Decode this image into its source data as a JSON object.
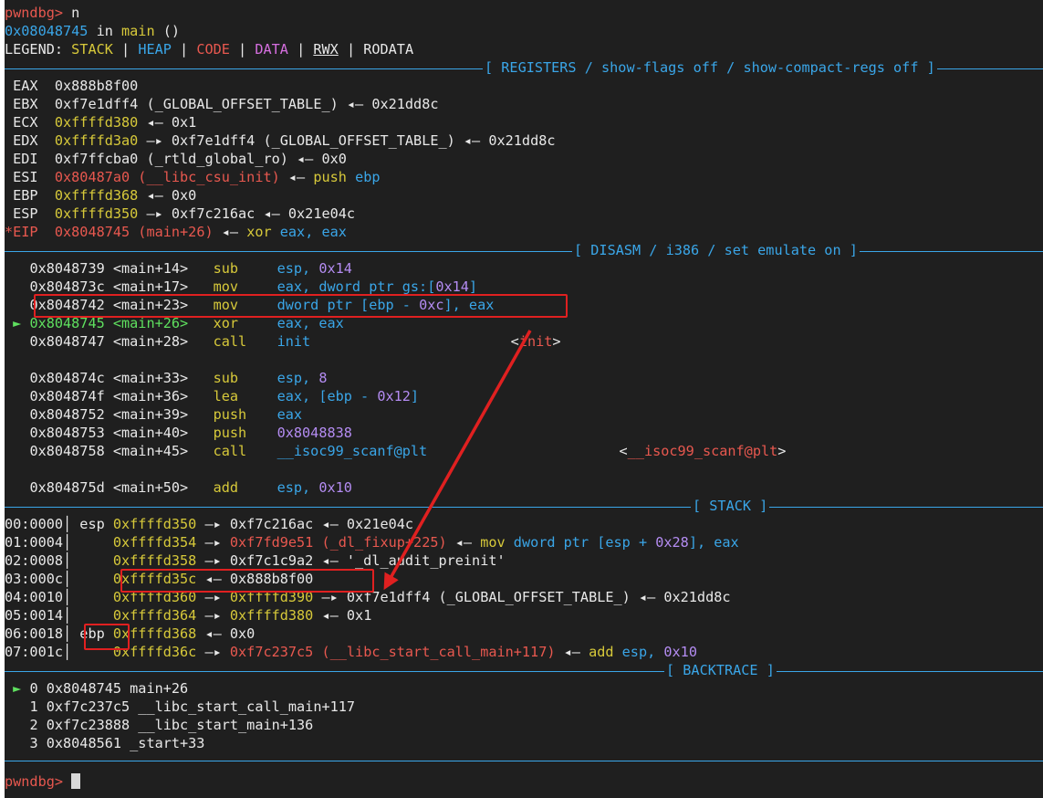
{
  "prompt": "pwndbg> ",
  "command": "n",
  "location": {
    "addr": "0x08048745",
    "in": " in ",
    "func": "main",
    "args": " ()"
  },
  "legend": {
    "label": "LEGEND: ",
    "stack": "STACK",
    "heap": "HEAP",
    "code": "CODE",
    "data": "DATA",
    "rwx": "RWX",
    "rodata": "RODATA",
    "sep": " | "
  },
  "headers": {
    "registers": "[ REGISTERS / show-flags off / show-compact-regs off ]",
    "disasm": "[ DISASM / i386 / set emulate on ]",
    "stack": "[ STACK ]",
    "backtrace": "[ BACKTRACE ]"
  },
  "registers": [
    {
      "name": " EAX",
      "segs": [
        {
          "t": "0x888b8f00",
          "c": "wht"
        }
      ]
    },
    {
      "name": " EBX",
      "segs": [
        {
          "t": "0xf7e1dff4 (_GLOBAL_OFFSET_TABLE_) ",
          "c": "wht"
        },
        {
          "t": "◂— ",
          "c": "wht"
        },
        {
          "t": "0x21dd8c",
          "c": "wht"
        }
      ]
    },
    {
      "name": " ECX",
      "segs": [
        {
          "t": "0xffffd380",
          "c": "yel"
        },
        {
          "t": " ◂— 0x1",
          "c": "wht"
        }
      ]
    },
    {
      "name": " EDX",
      "segs": [
        {
          "t": "0xffffd3a0",
          "c": "yel"
        },
        {
          "t": " —▸ 0xf7e1dff4 (_GLOBAL_OFFSET_TABLE_) ◂— 0x21dd8c",
          "c": "wht"
        }
      ]
    },
    {
      "name": " EDI",
      "segs": [
        {
          "t": "0xf7ffcba0 (_rtld_global_ro) ◂— 0x0",
          "c": "wht"
        }
      ]
    },
    {
      "name": " ESI",
      "segs": [
        {
          "t": "0x80487a0 (__libc_csu_init)",
          "c": "red"
        },
        {
          "t": " ◂— ",
          "c": "wht"
        },
        {
          "t": "push",
          "c": "yel"
        },
        {
          "t": " ebp",
          "c": "blu"
        }
      ]
    },
    {
      "name": " EBP",
      "segs": [
        {
          "t": "0xffffd368",
          "c": "yel"
        },
        {
          "t": " ◂— 0x0",
          "c": "wht"
        }
      ]
    },
    {
      "name": " ESP",
      "segs": [
        {
          "t": "0xffffd350",
          "c": "yel"
        },
        {
          "t": " —▸ 0xf7c216ac ◂— 0x21e04c",
          "c": "wht"
        }
      ]
    },
    {
      "name": "*EIP",
      "namec": "red",
      "segs": [
        {
          "t": "0x8048745 (main+26)",
          "c": "red"
        },
        {
          "t": " ◂— ",
          "c": "wht"
        },
        {
          "t": "xor",
          "c": "yel"
        },
        {
          "t": " eax, eax",
          "c": "blu"
        }
      ]
    }
  ],
  "disasm": [
    {
      "pre": "   ",
      "addr": "0x8048739 <main+14>   ",
      "op": "sub",
      "args": [
        {
          "t": "esp, ",
          "c": "blu"
        },
        {
          "t": "0x14",
          "c": "pur"
        }
      ]
    },
    {
      "pre": "   ",
      "addr": "0x804873c <main+17>   ",
      "op": "mov",
      "args": [
        {
          "t": "eax, dword ptr gs:[",
          "c": "blu"
        },
        {
          "t": "0x14",
          "c": "pur"
        },
        {
          "t": "]",
          "c": "blu"
        }
      ]
    },
    {
      "pre": "   ",
      "addr": "0x8048742 <main+23>   ",
      "op": "mov",
      "args": [
        {
          "t": "dword ptr [ebp - ",
          "c": "blu"
        },
        {
          "t": "0xc",
          "c": "pur"
        },
        {
          "t": "], eax",
          "c": "blu"
        }
      ]
    },
    {
      "pre": " ► ",
      "cur": true,
      "addr": "0x8048745 <main+26>   ",
      "op": "xor",
      "args": [
        {
          "t": "eax, eax",
          "c": "blu"
        }
      ]
    },
    {
      "pre": "   ",
      "addr": "0x8048747 <main+28>   ",
      "op": "call",
      "args": [
        {
          "t": "init",
          "c": "blu"
        },
        {
          "t": "                        ",
          "c": "wht"
        },
        {
          "t": "<",
          "c": "wht"
        },
        {
          "t": "init",
          "c": "red"
        },
        {
          "t": ">",
          "c": "wht"
        }
      ]
    },
    {
      "blank": true
    },
    {
      "pre": "   ",
      "addr": "0x804874c <main+33>   ",
      "op": "sub",
      "args": [
        {
          "t": "esp, ",
          "c": "blu"
        },
        {
          "t": "8",
          "c": "pur"
        }
      ]
    },
    {
      "pre": "   ",
      "addr": "0x804874f <main+36>   ",
      "op": "lea",
      "args": [
        {
          "t": "eax, [ebp - ",
          "c": "blu"
        },
        {
          "t": "0x12",
          "c": "pur"
        },
        {
          "t": "]",
          "c": "blu"
        }
      ]
    },
    {
      "pre": "   ",
      "addr": "0x8048752 <main+39>   ",
      "op": "push",
      "args": [
        {
          "t": "eax",
          "c": "blu"
        }
      ]
    },
    {
      "pre": "   ",
      "addr": "0x8048753 <main+40>   ",
      "op": "push",
      "args": [
        {
          "t": "0x8048838",
          "c": "pur"
        }
      ]
    },
    {
      "pre": "   ",
      "addr": "0x8048758 <main+45>   ",
      "op": "call",
      "args": [
        {
          "t": "__isoc99_scanf@plt",
          "c": "blu"
        },
        {
          "t": "                       ",
          "c": "wht"
        },
        {
          "t": "<",
          "c": "wht"
        },
        {
          "t": "__isoc99_scanf@plt",
          "c": "red"
        },
        {
          "t": ">",
          "c": "wht"
        }
      ]
    },
    {
      "blank": true
    },
    {
      "pre": "   ",
      "addr": "0x804875d <main+50>   ",
      "op": "add",
      "args": [
        {
          "t": "esp, ",
          "c": "blu"
        },
        {
          "t": "0x10",
          "c": "pur"
        }
      ]
    }
  ],
  "stack": [
    {
      "idx": "00:0000│ ",
      "reg": "esp ",
      "segs": [
        {
          "t": "0xffffd350",
          "c": "yel"
        },
        {
          "t": " —▸ 0xf7c216ac ◂— 0x21e04c",
          "c": "wht"
        }
      ]
    },
    {
      "idx": "01:0004│ ",
      "reg": "    ",
      "segs": [
        {
          "t": "0xffffd354",
          "c": "yel"
        },
        {
          "t": " —▸ ",
          "c": "wht"
        },
        {
          "t": "0xf7fd9e51 (_dl_fixup+225)",
          "c": "red"
        },
        {
          "t": " ◂— ",
          "c": "wht"
        },
        {
          "t": "mov",
          "c": "yel"
        },
        {
          "t": " dword ptr [esp + ",
          "c": "blu"
        },
        {
          "t": "0x28",
          "c": "pur"
        },
        {
          "t": "], eax",
          "c": "blu"
        }
      ]
    },
    {
      "idx": "02:0008│ ",
      "reg": "    ",
      "segs": [
        {
          "t": "0xffffd358",
          "c": "yel"
        },
        {
          "t": " —▸ 0xf7c1c9a2 ◂— '_dl_audit_preinit'",
          "c": "wht"
        }
      ]
    },
    {
      "idx": "03:000c│ ",
      "reg": "    ",
      "segs": [
        {
          "t": "0xffffd35c",
          "c": "yel"
        },
        {
          "t": " ◂— 0x888b8f00",
          "c": "wht"
        }
      ]
    },
    {
      "idx": "04:0010│ ",
      "reg": "    ",
      "segs": [
        {
          "t": "0xffffd360",
          "c": "yel"
        },
        {
          "t": " —▸ ",
          "c": "wht"
        },
        {
          "t": "0xffffd390",
          "c": "yel"
        },
        {
          "t": " —▸ 0xf7e1dff4 (_GLOBAL_OFFSET_TABLE_) ◂— 0x21dd8c",
          "c": "wht"
        }
      ]
    },
    {
      "idx": "05:0014│ ",
      "reg": "    ",
      "segs": [
        {
          "t": "0xffffd364",
          "c": "yel"
        },
        {
          "t": " —▸ ",
          "c": "wht"
        },
        {
          "t": "0xffffd380",
          "c": "yel"
        },
        {
          "t": " ◂— 0x1",
          "c": "wht"
        }
      ]
    },
    {
      "idx": "06:0018│ ",
      "reg": "ebp ",
      "segs": [
        {
          "t": "0xffffd368",
          "c": "yel"
        },
        {
          "t": " ◂— 0x0",
          "c": "wht"
        }
      ]
    },
    {
      "idx": "07:001c│ ",
      "reg": "    ",
      "segs": [
        {
          "t": "0xffffd36c",
          "c": "yel"
        },
        {
          "t": " —▸ ",
          "c": "wht"
        },
        {
          "t": "0xf7c237c5 (__libc_start_call_main+117)",
          "c": "red"
        },
        {
          "t": " ◂— ",
          "c": "wht"
        },
        {
          "t": "add",
          "c": "yel"
        },
        {
          "t": " esp, ",
          "c": "blu"
        },
        {
          "t": "0x10",
          "c": "pur"
        }
      ]
    }
  ],
  "backtrace": [
    {
      "pre": " ► ",
      "text": "0 0x8048745 main+26"
    },
    {
      "pre": "   ",
      "text": "1 0xf7c237c5 __libc_start_call_main+117"
    },
    {
      "pre": "   ",
      "text": "2 0xf7c23888 __libc_start_main+136"
    },
    {
      "pre": "   ",
      "text": "3 0x8048561 _start+33"
    }
  ],
  "colors": {
    "annotation": "#e02020",
    "accent": "#3aa6e8",
    "background": "#1f1f1f"
  }
}
